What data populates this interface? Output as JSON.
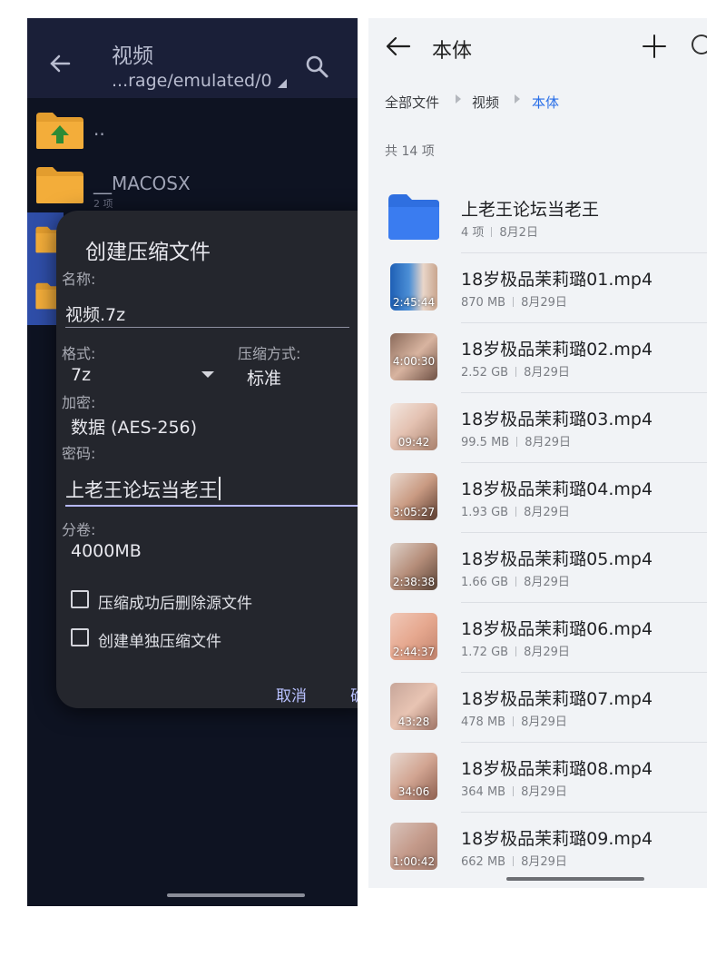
{
  "left": {
    "appbar": {
      "title": "视频",
      "path": "...rage/emulated/0"
    },
    "folders": [
      {
        "name": "..",
        "sub": ""
      },
      {
        "name": "__MACOSX",
        "sub": "2 项"
      }
    ],
    "dialog": {
      "title": "创建压缩文件",
      "name_label": "名称:",
      "name_value": "视频.7z",
      "format_label": "格式:",
      "format_value": "7z",
      "method_label": "压缩方式:",
      "method_value": "标准",
      "encryption_label": "加密:",
      "encryption_value": "数据 (AES-256)",
      "password_label": "密码:",
      "password_value": "上老王论坛当老王",
      "split_label": "分卷:",
      "split_value": "4000MB",
      "checkbox_delete": "压缩成功后删除源文件",
      "checkbox_separate": "创建单独压缩文件",
      "cancel": "取消",
      "confirm": "确"
    }
  },
  "right": {
    "title": "本体",
    "breadcrumb": [
      "全部文件",
      "视频",
      "本体"
    ],
    "count": "共 14 项",
    "colors": {
      "accent": "#2a6fe8",
      "folder": "#2f6fe0"
    },
    "items": [
      {
        "name": "上老王论坛当老王",
        "size": "4 项",
        "date": "8月2日",
        "duration": "",
        "type": "folder"
      },
      {
        "name": "18岁极品茉莉璐01.mp4",
        "size": "870 MB",
        "date": "8月29日",
        "duration": "2:45:44",
        "type": "video"
      },
      {
        "name": "18岁极品茉莉璐02.mp4",
        "size": "2.52 GB",
        "date": "8月29日",
        "duration": "4:00:30",
        "type": "video"
      },
      {
        "name": "18岁极品茉莉璐03.mp4",
        "size": "99.5 MB",
        "date": "8月29日",
        "duration": "09:42",
        "type": "video"
      },
      {
        "name": "18岁极品茉莉璐04.mp4",
        "size": "1.93 GB",
        "date": "8月29日",
        "duration": "3:05:27",
        "type": "video"
      },
      {
        "name": "18岁极品茉莉璐05.mp4",
        "size": "1.66 GB",
        "date": "8月29日",
        "duration": "2:38:38",
        "type": "video"
      },
      {
        "name": "18岁极品茉莉璐06.mp4",
        "size": "1.72 GB",
        "date": "8月29日",
        "duration": "2:44:37",
        "type": "video"
      },
      {
        "name": "18岁极品茉莉璐07.mp4",
        "size": "478 MB",
        "date": "8月29日",
        "duration": "43:28",
        "type": "video"
      },
      {
        "name": "18岁极品茉莉璐08.mp4",
        "size": "364 MB",
        "date": "8月29日",
        "duration": "34:06",
        "type": "video"
      },
      {
        "name": "18岁极品茉莉璐09.mp4",
        "size": "662 MB",
        "date": "8月29日",
        "duration": "1:00:42",
        "type": "video"
      }
    ]
  }
}
